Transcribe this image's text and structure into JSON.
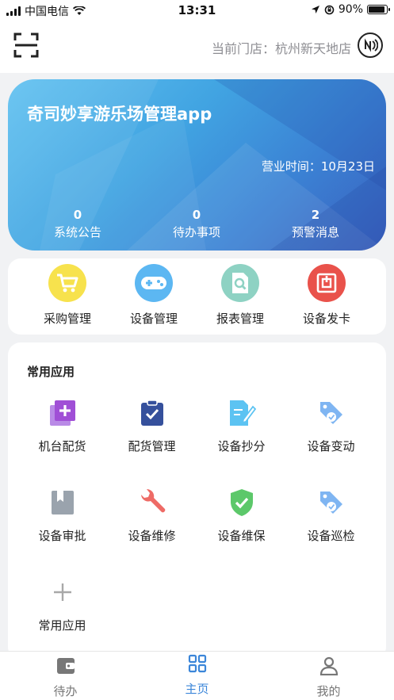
{
  "status_bar": {
    "carrier": "中国电信",
    "time": "13:31",
    "battery": "90%",
    "battery_level": 0.9
  },
  "header": {
    "store_label": "当前门店：杭州新天地店"
  },
  "banner": {
    "title": "奇司妙享游乐场管理app",
    "business_time": "营业时间：10月23日",
    "stats": [
      {
        "value": "0",
        "label": "系统公告"
      },
      {
        "value": "0",
        "label": "待办事项"
      },
      {
        "value": "2",
        "label": "预警消息"
      }
    ]
  },
  "quick_actions": [
    {
      "label": "采购管理",
      "icon": "cart-icon",
      "color": "#f7e24d"
    },
    {
      "label": "设备管理",
      "icon": "gamepad-icon",
      "color": "#5cb7f2"
    },
    {
      "label": "报表管理",
      "icon": "report-search-icon",
      "color": "#8ed2c3"
    },
    {
      "label": "设备发卡",
      "icon": "card-issue-icon",
      "color": "#e9524b"
    }
  ],
  "common_apps": {
    "title": "常用应用",
    "items": [
      {
        "label": "机台配货",
        "icon": "add-stack-icon",
        "color": "#a04fd6"
      },
      {
        "label": "配货管理",
        "icon": "clipboard-check-icon",
        "color": "#35509c"
      },
      {
        "label": "设备抄分",
        "icon": "document-edit-icon",
        "color": "#5cc3f2"
      },
      {
        "label": "设备变动",
        "icon": "tag-check-icon",
        "color": "#7fb5f2"
      },
      {
        "label": "设备审批",
        "icon": "bookmark-icon",
        "color": "#9aa3ad"
      },
      {
        "label": "设备维修",
        "icon": "wrench-icon",
        "color": "#ee6b66"
      },
      {
        "label": "设备维保",
        "icon": "shield-check-icon",
        "color": "#5cc86a"
      },
      {
        "label": "设备巡检",
        "icon": "tag-check-icon",
        "color": "#7fb5f2"
      },
      {
        "label": "常用应用",
        "icon": "plus-icon",
        "color": "#a8a8a8"
      }
    ]
  },
  "tabbar": [
    {
      "label": "待办",
      "icon": "wallet-icon",
      "active": false
    },
    {
      "label": "主页",
      "icon": "grid-icon",
      "active": true
    },
    {
      "label": "我的",
      "icon": "user-icon",
      "active": false
    }
  ],
  "colors": {
    "accent": "#3b86d9",
    "banner_start": "#62c2f0",
    "banner_end": "#3a5fbe"
  }
}
